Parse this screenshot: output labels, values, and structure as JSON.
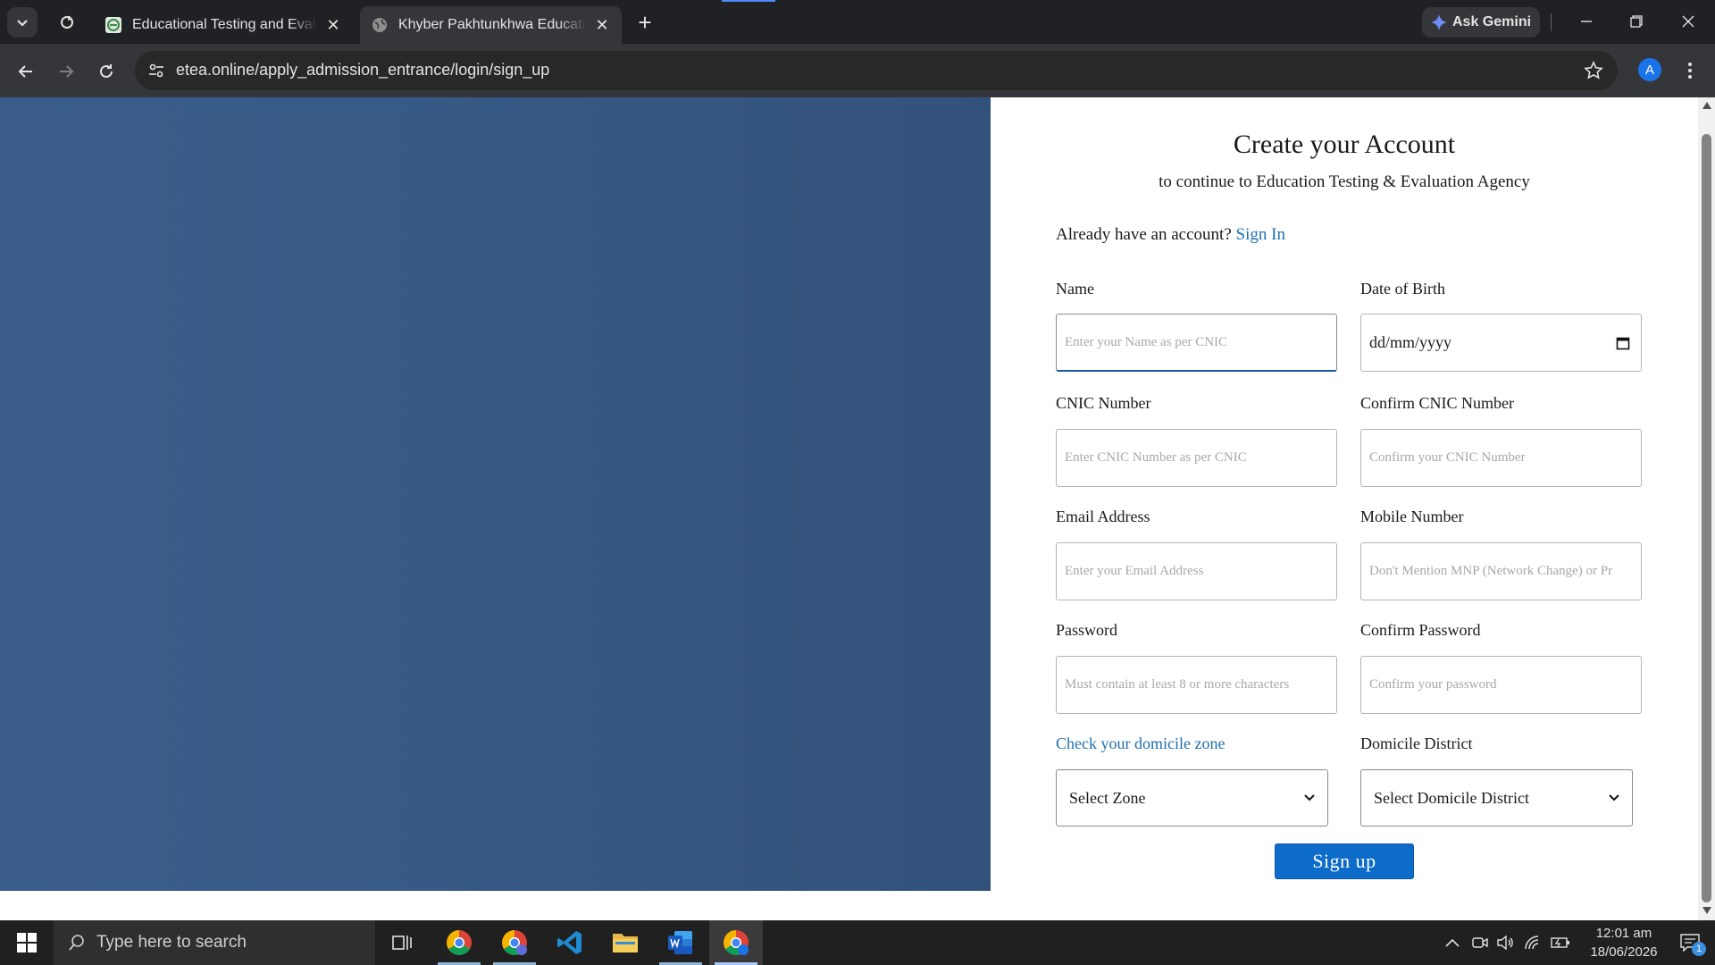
{
  "browser": {
    "tabs": [
      {
        "title": "Educational Testing and Evaluation Agency",
        "active": false
      },
      {
        "title": "Khyber Pakhtunkhwa Education Testing",
        "active": true
      }
    ],
    "ask_gemini": "Ask Gemini",
    "url": "etea.online/apply_admission_entrance/login/sign_up",
    "profile_initial": "A"
  },
  "form": {
    "title": "Create your Account",
    "subtitle": "to continue to Education Testing & Evaluation Agency",
    "signin_prompt": "Already have an account?",
    "signin_link": "Sign In",
    "name": {
      "label": "Name",
      "placeholder": "Enter your Name as per CNIC"
    },
    "dob": {
      "label": "Date of Birth",
      "placeholder": "dd/mm/yyyy"
    },
    "cnic": {
      "label": "CNIC Number",
      "placeholder": "Enter CNIC Number as per CNIC"
    },
    "confirm_cnic": {
      "label": "Confirm CNIC Number",
      "placeholder": "Confirm your CNIC Number"
    },
    "email": {
      "label": "Email Address",
      "placeholder": "Enter your Email Address"
    },
    "mobile": {
      "label": "Mobile Number",
      "placeholder": "Don't Mention MNP (Network Change) or Pr"
    },
    "password": {
      "label": "Password",
      "placeholder": "Must contain at least 8 or more characters"
    },
    "confirm_password": {
      "label": "Confirm Password",
      "placeholder": "Confirm your password"
    },
    "zone": {
      "label": "Check your domicile zone",
      "selected": "Select Zone"
    },
    "district": {
      "label": "Domicile District",
      "selected": "Select Domicile District"
    },
    "submit": "Sign up"
  },
  "taskbar": {
    "search_placeholder": "Type here to search",
    "time": "12:01 am",
    "date": "18/06/2026",
    "notification_count": "1"
  },
  "colors": {
    "panel_blue": "#365883",
    "button_blue": "#0d6cc9",
    "link_blue": "#1f6fae"
  }
}
